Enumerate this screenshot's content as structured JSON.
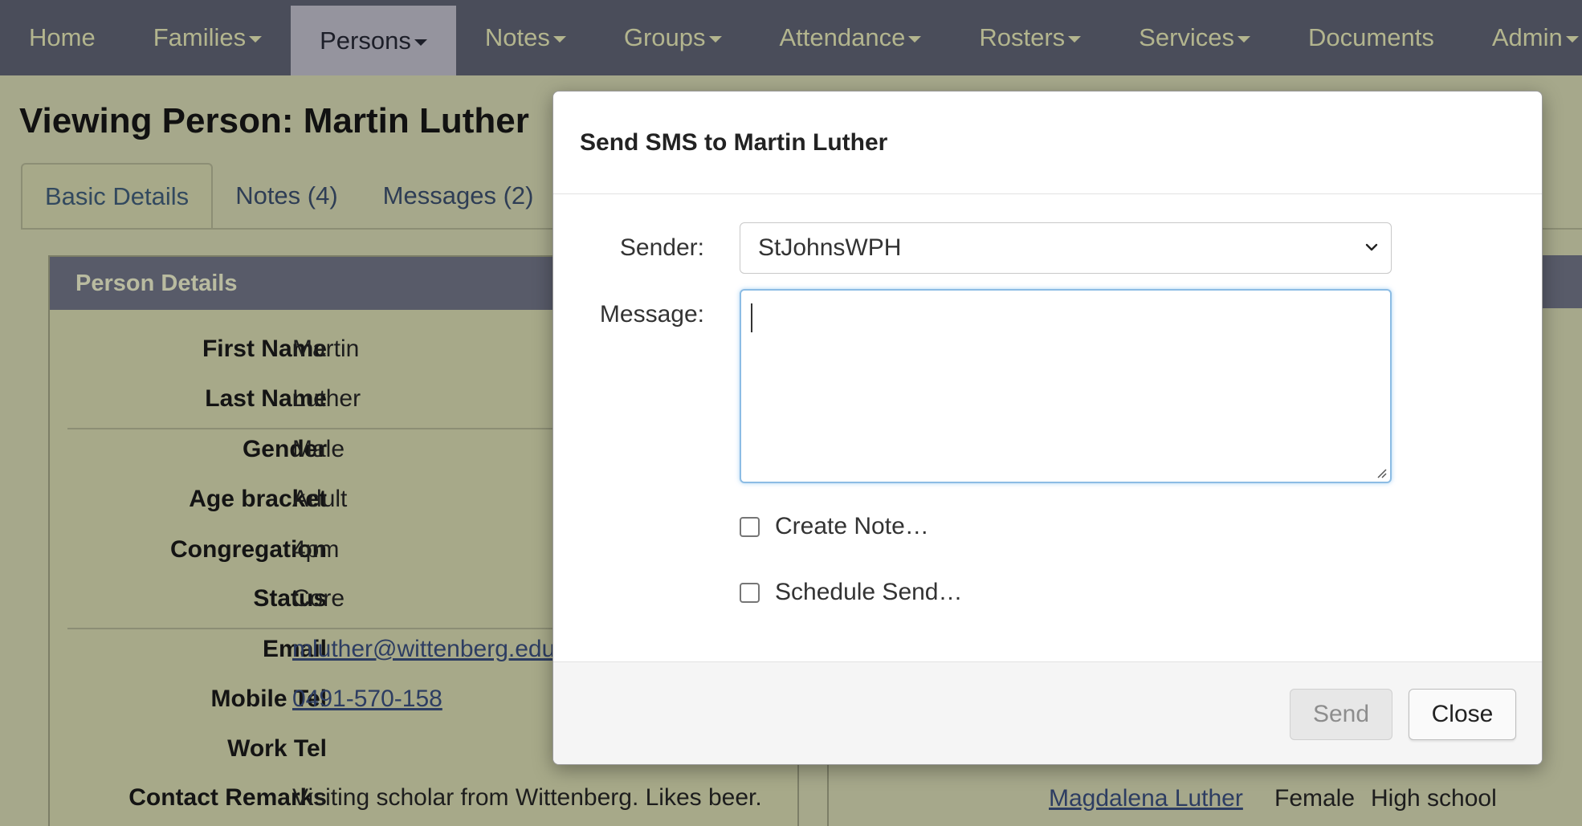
{
  "nav": {
    "items": [
      {
        "label": "Home",
        "dropdown": false,
        "active": false
      },
      {
        "label": "Families",
        "dropdown": true,
        "active": false
      },
      {
        "label": "Persons",
        "dropdown": true,
        "active": true
      },
      {
        "label": "Notes",
        "dropdown": true,
        "active": false
      },
      {
        "label": "Groups",
        "dropdown": true,
        "active": false
      },
      {
        "label": "Attendance",
        "dropdown": true,
        "active": false
      },
      {
        "label": "Rosters",
        "dropdown": true,
        "active": false
      },
      {
        "label": "Services",
        "dropdown": true,
        "active": false
      },
      {
        "label": "Documents",
        "dropdown": false,
        "active": false
      },
      {
        "label": "Admin",
        "dropdown": true,
        "active": false
      }
    ]
  },
  "page": {
    "title": "Viewing Person: Martin Luther",
    "tabs": [
      {
        "label": "Basic Details",
        "active": true
      },
      {
        "label": "Notes (4)",
        "active": false
      },
      {
        "label": "Messages (2)",
        "active": false
      }
    ]
  },
  "person_details": {
    "heading": "Person Details",
    "fields": [
      {
        "label": "First Name",
        "value": "Martin",
        "link": false
      },
      {
        "label": "Last Name",
        "value": "Luther",
        "link": false
      },
      {
        "label": "Gender",
        "value": "Male",
        "link": false
      },
      {
        "label": "Age bracket",
        "value": "Adult",
        "link": false
      },
      {
        "label": "Congregation",
        "value": "4pm",
        "link": false
      },
      {
        "label": "Status",
        "value": "Core",
        "link": false
      },
      {
        "label": "Email",
        "value": "mluther@wittenberg.edu",
        "link": true
      },
      {
        "label": "Mobile Tel",
        "value": "0491-570-158",
        "link": true
      },
      {
        "label": "Work Tel",
        "value": "",
        "link": false
      },
      {
        "label": "Contact Remarks",
        "value": "Visiting scholar from Wittenberg. Likes beer.",
        "link": false
      }
    ]
  },
  "family_row": {
    "name": "Magdalena Luther",
    "gender": "Female",
    "age": "High school"
  },
  "modal": {
    "title": "Send SMS to Martin Luther",
    "sender_label": "Sender:",
    "sender_value": "StJohnsWPH",
    "message_label": "Message:",
    "message_value": "",
    "create_note_label": "Create Note…",
    "schedule_send_label": "Schedule Send…",
    "send_label": "Send",
    "close_label": "Close"
  },
  "colors": {
    "navbar": "#4a4d5a",
    "page_bg": "#a6a88b",
    "panel_head": "#585b69",
    "focus_border": "#8cbce4"
  }
}
